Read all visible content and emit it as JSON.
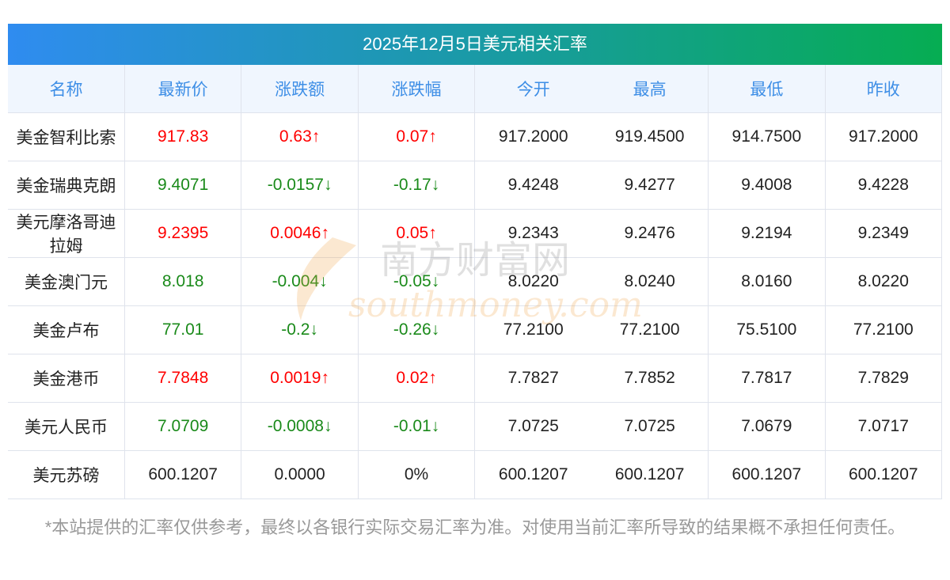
{
  "title": "2025年12月5日美元相关汇率",
  "headers": [
    "名称",
    "最新价",
    "涨跌额",
    "涨跌幅",
    "今开",
    "最高",
    "最低",
    "昨收"
  ],
  "rows": [
    {
      "name": "美金智利比索",
      "price": "917.83",
      "change": "0.63↑",
      "pct": "0.07↑",
      "dir": "up",
      "open": "917.2000",
      "high": "919.4500",
      "low": "914.7500",
      "prev": "917.2000"
    },
    {
      "name": "美金瑞典克朗",
      "price": "9.4071",
      "change": "-0.0157↓",
      "pct": "-0.17↓",
      "dir": "down",
      "open": "9.4248",
      "high": "9.4277",
      "low": "9.4008",
      "prev": "9.4228"
    },
    {
      "name": "美元摩洛哥迪拉姆",
      "price": "9.2395",
      "change": "0.0046↑",
      "pct": "0.05↑",
      "dir": "up",
      "open": "9.2343",
      "high": "9.2476",
      "low": "9.2194",
      "prev": "9.2349"
    },
    {
      "name": "美金澳门元",
      "price": "8.018",
      "change": "-0.004↓",
      "pct": "-0.05↓",
      "dir": "down",
      "open": "8.0220",
      "high": "8.0240",
      "low": "8.0160",
      "prev": "8.0220"
    },
    {
      "name": "美金卢布",
      "price": "77.01",
      "change": "-0.2↓",
      "pct": "-0.26↓",
      "dir": "down",
      "open": "77.2100",
      "high": "77.2100",
      "low": "75.5100",
      "prev": "77.2100"
    },
    {
      "name": "美金港币",
      "price": "7.7848",
      "change": "0.0019↑",
      "pct": "0.02↑",
      "dir": "up",
      "open": "7.7827",
      "high": "7.7852",
      "low": "7.7817",
      "prev": "7.7829"
    },
    {
      "name": "美元人民币",
      "price": "7.0709",
      "change": "-0.0008↓",
      "pct": "-0.01↓",
      "dir": "down",
      "open": "7.0725",
      "high": "7.0725",
      "low": "7.0679",
      "prev": "7.0717"
    },
    {
      "name": "美元苏磅",
      "price": "600.1207",
      "change": "0.0000",
      "pct": "0%",
      "dir": "flat",
      "open": "600.1207",
      "high": "600.1207",
      "low": "600.1207",
      "prev": "600.1207"
    }
  ],
  "watermark": {
    "cn": "南方财富网",
    "en": "southmoney.com"
  },
  "footer": "*本站提供的汇率仅供参考，最终以各银行实际交易汇率为准。对使用当前汇率所导致的结果概不承担任何责任。",
  "colors": {
    "up": "#ff0000",
    "down": "#1a8a1a",
    "header_text": "#3d8ee6"
  }
}
